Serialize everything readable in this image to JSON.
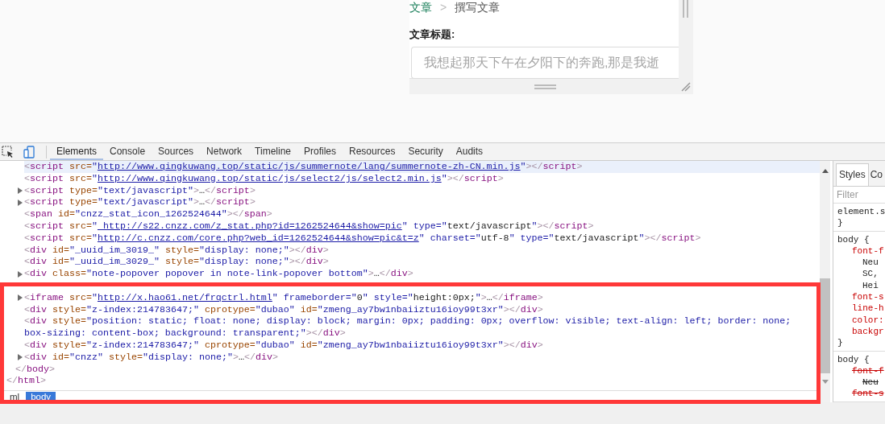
{
  "page": {
    "breadcrumb": [
      {
        "label": "文章",
        "kind": "link"
      },
      {
        "label": ">",
        "kind": "separator"
      },
      {
        "label": "撰写文章",
        "kind": "current"
      }
    ],
    "title_label": "文章标题:",
    "title_input": {
      "placeholder": "我想起那天下午在夕阳下的奔跑,那是我逝"
    }
  },
  "devtools": {
    "tabs": [
      {
        "label": "Elements",
        "selected": true
      },
      {
        "label": "Console",
        "selected": false
      },
      {
        "label": "Sources",
        "selected": false
      },
      {
        "label": "Network",
        "selected": false
      },
      {
        "label": "Timeline",
        "selected": false
      },
      {
        "label": "Profiles",
        "selected": false
      },
      {
        "label": "Resources",
        "selected": false
      },
      {
        "label": "Security",
        "selected": false
      },
      {
        "label": "Audits",
        "selected": false
      }
    ],
    "dom_tree": [
      {
        "close": "</html>",
        "children": [
          {
            "close": "</body>",
            "children": [
              {
                "expandable": false,
                "selected": true,
                "segments": [
                  {
                    "kind": "code",
                    "text": "<script src=\""
                  },
                  {
                    "kind": "link",
                    "text": "http://www.qingkuwang.top/static/js/summernote/lang/summernote-zh-CN.min.js"
                  },
                  {
                    "kind": "code",
                    "text": "\"></script>"
                  }
                ]
              },
              {
                "expandable": false,
                "selected": false,
                "segments": [
                  {
                    "kind": "code",
                    "text": "<script src=\""
                  },
                  {
                    "kind": "link",
                    "text": "http://www.qingkuwang.top/static/js/select2/js/select2.min.js"
                  },
                  {
                    "kind": "code",
                    "text": "\"></script>"
                  }
                ]
              },
              {
                "expandable": true,
                "selected": false,
                "segments": [
                  {
                    "kind": "code",
                    "text": "<script type=\"text/javascript\">…</script>"
                  }
                ]
              },
              {
                "expandable": true,
                "selected": false,
                "segments": [
                  {
                    "kind": "code",
                    "text": "<script type=\"text/javascript\">…</script>"
                  }
                ]
              },
              {
                "expandable": false,
                "selected": false,
                "segments": [
                  {
                    "kind": "code",
                    "text": "<span id=\"cnzz_stat_icon_1262524644\"></span>"
                  }
                ]
              },
              {
                "expandable": false,
                "selected": false,
                "segments": [
                  {
                    "kind": "code",
                    "text": "<script src=\""
                  },
                  {
                    "kind": "link",
                    "text": " http://s22.cnzz.com/z_stat.php?id=1262524644&show=pic"
                  },
                  {
                    "kind": "code",
                    "text": "\" type=\"text/javascript\"></script>"
                  }
                ]
              },
              {
                "expandable": false,
                "selected": false,
                "segments": [
                  {
                    "kind": "code",
                    "text": "<script src=\""
                  },
                  {
                    "kind": "link",
                    "text": "http://c.cnzz.com/core.php?web_id=1262524644&show=pic&t=z"
                  },
                  {
                    "kind": "code",
                    "text": "\" charset=\"utf-8\" type=\"text/javascript\"></script>"
                  }
                ]
              },
              {
                "expandable": false,
                "selected": false,
                "segments": [
                  {
                    "kind": "code",
                    "text": "<div id=\"_uuid_im_3019_\" style=\"display: none;\"></div>"
                  }
                ]
              },
              {
                "expandable": false,
                "selected": false,
                "segments": [
                  {
                    "kind": "code",
                    "text": "<div id=\"_uuid_im_3029_\" style=\"display: none;\"></div>"
                  }
                ]
              },
              {
                "expandable": true,
                "selected": false,
                "segments": [
                  {
                    "kind": "code",
                    "text": "<div class=\"note-popover popover in note-link-popover bottom\">…</div>"
                  }
                ]
              },
              {
                "kind": "covered"
              },
              {
                "expandable": true,
                "selected": false,
                "segments": [
                  {
                    "kind": "code",
                    "text": "<iframe src=\""
                  },
                  {
                    "kind": "link",
                    "text": "http://x.hao61.net/frqctrl.html"
                  },
                  {
                    "kind": "code",
                    "text": "\" frameborder=\"0\" style=\"height:0px;\">…</iframe>"
                  }
                ]
              },
              {
                "expandable": false,
                "selected": false,
                "segments": [
                  {
                    "kind": "code",
                    "text": "<div style=\"z-index:214783647;\" cprotype=\"dubao\" id=\"zmeng_ay7bw1nbaiiztu16ioy99t3xr\"></div>"
                  }
                ]
              },
              {
                "expandable": false,
                "selected": false,
                "segments": [
                  {
                    "kind": "code",
                    "text": "<div style=\"position: static; float: none; display: block; margin: 0px; padding: 0px; overflow: visible; text-align: left; border: none; box-sizing: content-box; background: transparent;\"></div>"
                  }
                ]
              },
              {
                "expandable": false,
                "selected": false,
                "segments": [
                  {
                    "kind": "code",
                    "text": "<div style=\"z-index:214783647;\" cprotype=\"dubao\" id=\"zmeng_ay7bw1nbaiiztu16ioy99t3xr\"></div>"
                  }
                ]
              },
              {
                "expandable": true,
                "selected": false,
                "segments": [
                  {
                    "kind": "code",
                    "text": "<div id=\"cnzz\" style=\"display: none;\">…</div>"
                  }
                ]
              }
            ]
          }
        ]
      }
    ],
    "breadcrumbs": [
      {
        "label": "ml",
        "selected": false
      },
      {
        "label": "body",
        "selected": true
      }
    ],
    "styles_pane": {
      "tabs": [
        {
          "label": "Styles",
          "selected": true
        },
        {
          "label": "Co",
          "selected": false
        }
      ],
      "filter": {
        "placeholder": "Filter"
      },
      "rules": [
        {
          "lines": [
            {
              "text": "element.s",
              "kind": "selector",
              "struck": false
            },
            {
              "text": "}",
              "kind": "selector",
              "struck": false
            }
          ]
        },
        {
          "lines": [
            {
              "text": "body {",
              "kind": "selector",
              "struck": false
            },
            {
              "text": "font-f",
              "kind": "prop",
              "struck": false
            },
            {
              "text": "Neu",
              "kind": "cont",
              "struck": false
            },
            {
              "text": "SC,",
              "kind": "cont",
              "struck": false
            },
            {
              "text": "Hei",
              "kind": "cont",
              "struck": false
            },
            {
              "text": "font-s",
              "kind": "prop",
              "struck": false
            },
            {
              "text": "line-h",
              "kind": "prop",
              "struck": false
            },
            {
              "text": "color:",
              "kind": "prop",
              "struck": false
            },
            {
              "text": "backgr",
              "kind": "prop",
              "struck": false
            },
            {
              "text": "}",
              "kind": "selector",
              "struck": false
            }
          ]
        },
        {
          "lines": [
            {
              "text": "body {",
              "kind": "selector",
              "struck": false
            },
            {
              "text": "font-f",
              "kind": "prop",
              "struck": true
            },
            {
              "text": "Neu",
              "kind": "cont",
              "struck": true
            },
            {
              "text": "font-s",
              "kind": "prop",
              "struck": true
            }
          ]
        }
      ]
    }
  }
}
